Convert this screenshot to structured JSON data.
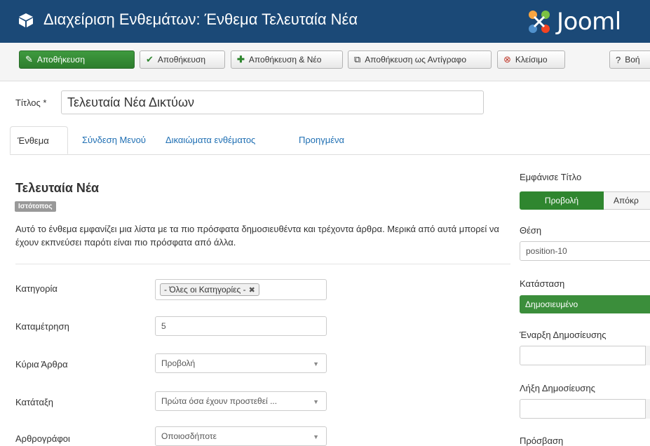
{
  "header": {
    "title": "Διαχείριση Ενθεμάτων: Ένθεμα Τελευταία Νέα",
    "logo_text": "Joomla",
    "logo_visible": "Jooml"
  },
  "toolbar": {
    "save_primary": "Αποθήκευση",
    "save_close": "Αποθήκευση",
    "save_new": "Αποθήκευση & Νέο",
    "save_copy": "Αποθήκευση ως Αντίγραφο",
    "close": "Κλείσιμο",
    "help": "Βοή"
  },
  "title_field": {
    "label": "Τίτλος *",
    "value": "Τελευταία Νέα Δικτύων"
  },
  "tabs": [
    "Ένθεμα",
    "Σύνδεση Μενού",
    "Δικαιώματα ενθέματος",
    "Προηγμένα"
  ],
  "module": {
    "name": "Τελευταία Νέα",
    "badge": "Ιστότοπος",
    "description": "Αυτό το ένθεμα εμφανίζει μια λίστα με τα πιο πρόσφατα δημοσιευθέντα και τρέχοντα άρθρα. Μερικά από αυτά μπορεί να έχουν εκπνεύσει παρότι είναι πιο πρόσφατα από άλλα."
  },
  "fields": {
    "category_label": "Κατηγορία",
    "category_chip": "- Όλες οι Κατηγορίες -",
    "count_label": "Καταμέτρηση",
    "count_value": "5",
    "featured_label": "Κύρια Άρθρα",
    "featured_value": "Προβολή",
    "order_label": "Κατάταξη",
    "order_value": "Πρώτα όσα έχουν προστεθεί ...",
    "authors_label": "Αρθρογράφοι",
    "authors_value": "Οποιοσδήποτε"
  },
  "sidebar": {
    "show_title_label": "Εμφάνισε Τίτλο",
    "show_on": "Προβολή",
    "show_off": "Απόκρ",
    "position_label": "Θέση",
    "position_value": "position-10",
    "status_label": "Κατάσταση",
    "status_value": "Δημοσιευμένο",
    "publish_up_label": "Έναρξη Δημοσίευσης",
    "publish_down_label": "Λήξη Δημοσίευσης",
    "access_label": "Πρόσβαση"
  },
  "colors": {
    "header_bg": "#1b4977",
    "success": "#2f862f",
    "link": "#1f6fb3"
  }
}
